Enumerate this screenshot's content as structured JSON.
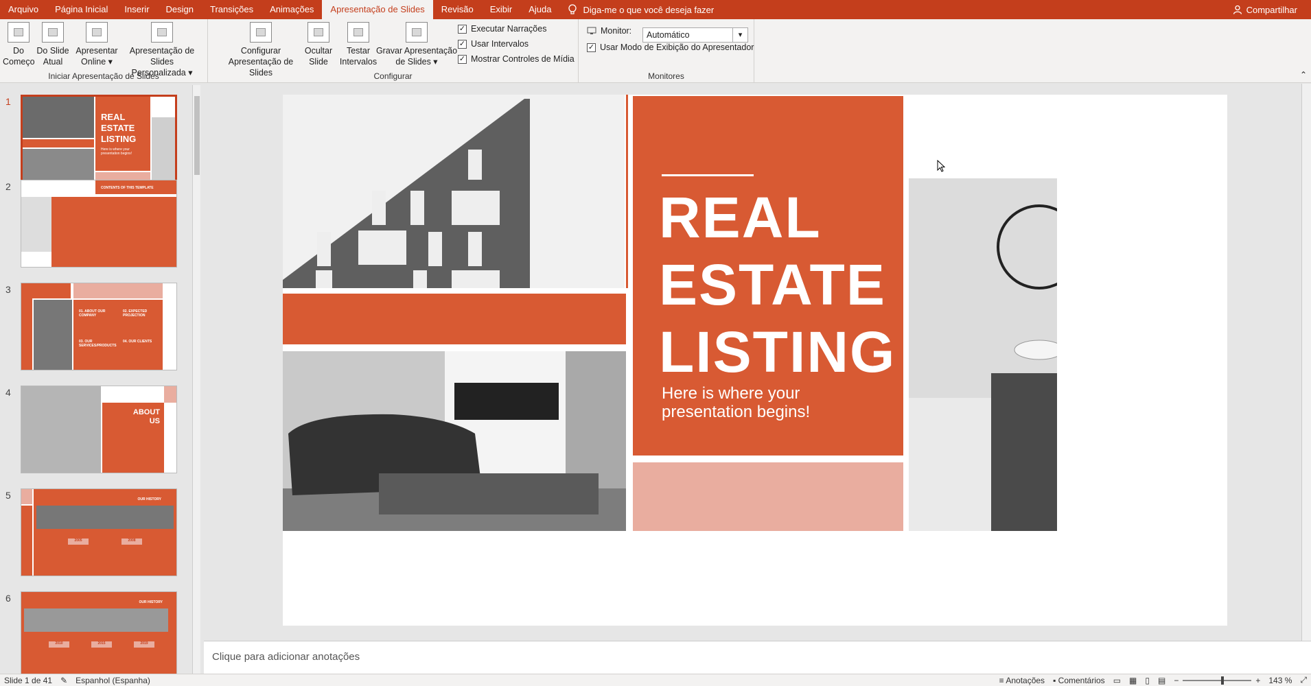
{
  "menubar": {
    "tabs": [
      "Arquivo",
      "Página Inicial",
      "Inserir",
      "Design",
      "Transições",
      "Animações",
      "Apresentação de Slides",
      "Revisão",
      "Exibir",
      "Ajuda"
    ],
    "tellme": "Diga-me o que você deseja fazer",
    "share": "Compartilhar",
    "accent": "#c43e1c"
  },
  "ribbon": {
    "group1": {
      "label": "Iniciar Apresentação de Slides",
      "from_beginning": [
        "Do",
        "Começo"
      ],
      "from_current": [
        "Do Slide",
        "Atual"
      ],
      "present_online": [
        "Apresentar",
        "Online ▾"
      ],
      "custom_show": [
        "Apresentação de Slides",
        "Personalizada ▾"
      ]
    },
    "group2": {
      "label": "Configurar",
      "setup": [
        "Configurar",
        "Apresentação de Slides"
      ],
      "hide": [
        "Ocultar",
        "Slide"
      ],
      "rehearse": [
        "Testar",
        "Intervalos"
      ],
      "record": [
        "Gravar Apresentação",
        "de Slides ▾"
      ],
      "play_narrations": "Executar Narrações",
      "use_timings": "Usar Intervalos",
      "show_media_controls": "Mostrar Controles de Mídia"
    },
    "group3": {
      "label": "Monitores",
      "monitor_label": "Monitor:",
      "monitor_value": "Automático",
      "presenter_view": "Usar Modo de Exibição do Apresentador"
    }
  },
  "thumbs": {
    "numbers": [
      "1",
      "2",
      "3",
      "4",
      "5",
      "6"
    ],
    "t1_title": [
      "REAL",
      "ESTATE",
      "LISTING"
    ],
    "t1_sub": "Here is where your presentation begins!",
    "t2_title": "CONTENTS OF THIS TEMPLATE",
    "t3_items": [
      "01. ABOUT OUR COMPANY",
      "02. EXPECTED PROJECTION",
      "03. OUR SERVICES/PRODUCTS",
      "04. OUR CLIENTS"
    ],
    "t4_title": [
      "ABOUT",
      "US"
    ],
    "t5_title": "OUR HISTORY",
    "t5_years": [
      "2005",
      "2008"
    ],
    "t6_title": "OUR HISTORY",
    "t6_years": [
      "2010",
      "2015",
      "2019"
    ]
  },
  "slide": {
    "title": [
      "REAL",
      "ESTATE",
      "LISTING"
    ],
    "subtitle": [
      "Here is where your",
      "presentation begins!"
    ],
    "orange": "#d85a33",
    "pink": "#e9ad9f"
  },
  "notes": {
    "placeholder": "Clique para adicionar anotações"
  },
  "status": {
    "slide_info": "Slide 1 de 41",
    "language": "Espanhol (Espanha)",
    "notes_btn": "Anotações",
    "comments_btn": "Comentários",
    "zoom": "143 %"
  }
}
